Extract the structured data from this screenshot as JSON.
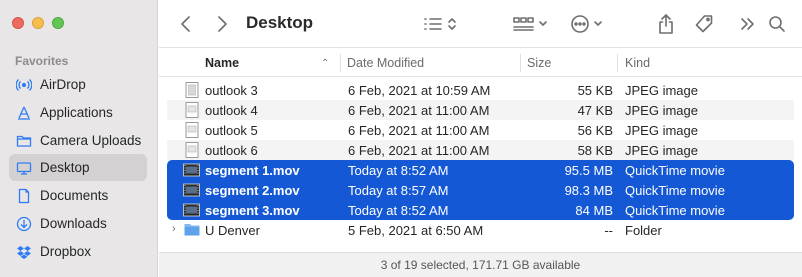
{
  "window": {
    "title": "Desktop"
  },
  "sidebar": {
    "heading": "Favorites",
    "items": [
      {
        "label": "AirDrop",
        "icon": "airdrop-icon"
      },
      {
        "label": "Applications",
        "icon": "applications-icon"
      },
      {
        "label": "Camera Uploads",
        "icon": "folder-icon"
      },
      {
        "label": "Desktop",
        "icon": "desktop-icon",
        "selected": true
      },
      {
        "label": "Documents",
        "icon": "document-icon"
      },
      {
        "label": "Downloads",
        "icon": "downloads-icon"
      },
      {
        "label": "Dropbox",
        "icon": "dropbox-icon"
      }
    ]
  },
  "columns": {
    "name": "Name",
    "date": "Date Modified",
    "size": "Size",
    "kind": "Kind"
  },
  "files": [
    {
      "name": "outlook 3",
      "date": "6 Feb, 2021 at 10:59 AM",
      "size": "55 KB",
      "kind": "JPEG image",
      "type": "image",
      "selected": false
    },
    {
      "name": "outlook 4",
      "date": "6 Feb, 2021 at 11:00 AM",
      "size": "47 KB",
      "kind": "JPEG image",
      "type": "image",
      "selected": false
    },
    {
      "name": "outlook 5",
      "date": "6 Feb, 2021 at 11:00 AM",
      "size": "56 KB",
      "kind": "JPEG image",
      "type": "image",
      "selected": false
    },
    {
      "name": "outlook 6",
      "date": "6 Feb, 2021 at 11:00 AM",
      "size": "58 KB",
      "kind": "JPEG image",
      "type": "image",
      "selected": false
    },
    {
      "name": "segment 1.mov",
      "date": "Today at 8:52 AM",
      "size": "95.5 MB",
      "kind": "QuickTime movie",
      "type": "movie",
      "selected": true
    },
    {
      "name": "segment 2.mov",
      "date": "Today at 8:57 AM",
      "size": "98.3 MB",
      "kind": "QuickTime movie",
      "type": "movie",
      "selected": true
    },
    {
      "name": "segment 3.mov",
      "date": "Today at 8:52 AM",
      "size": "84 MB",
      "kind": "QuickTime movie",
      "type": "movie",
      "selected": true
    },
    {
      "name": "U Denver",
      "date": "5 Feb, 2021 at 6:50 AM",
      "size": "--",
      "kind": "Folder",
      "type": "folder",
      "selected": false
    }
  ],
  "status": {
    "text": "3 of 19 selected, 171.71 GB available"
  },
  "colors": {
    "selection": "#1458d6",
    "accent": "#2f7cf6",
    "sidebar_bg": "#e8e6e6"
  }
}
